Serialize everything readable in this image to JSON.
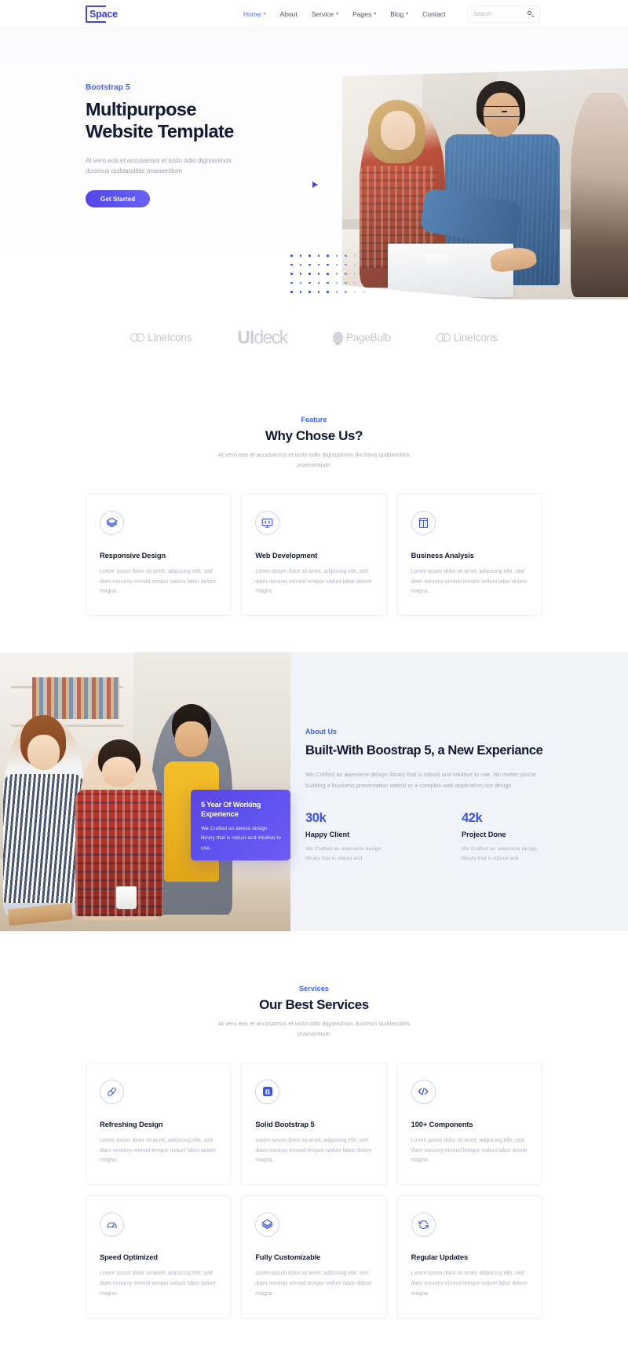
{
  "header": {
    "logo_text": "Space",
    "nav": [
      {
        "label": "Home",
        "caret": true,
        "active": true
      },
      {
        "label": "About",
        "caret": false,
        "active": false
      },
      {
        "label": "Service",
        "caret": true,
        "active": false
      },
      {
        "label": "Pages",
        "caret": true,
        "active": false
      },
      {
        "label": "Blog",
        "caret": true,
        "active": false
      },
      {
        "label": "Contact",
        "caret": false,
        "active": false
      }
    ],
    "search_placeholder": "Search",
    "search_value": ""
  },
  "hero": {
    "eyebrow": "Bootstrap 5",
    "title_line1": "Multipurpose",
    "title_line2": "Website Template",
    "subtitle": "At vero eos et accusamus et iusto odio dignissimos ducimus quiblanditiis praesentium",
    "cta_label": "Get Started"
  },
  "brands": [
    {
      "name": "LineIcons",
      "mark": "infinity-icon"
    },
    {
      "name": "UIdeck",
      "mark": "uideck-wordmark"
    },
    {
      "name": "PageBulb",
      "mark": "bulb-icon"
    },
    {
      "name": "LineIcons",
      "mark": "infinity-icon"
    }
  ],
  "feature": {
    "eyebrow": "Feature",
    "title": "Why Chose Us?",
    "description": "At vero eos et accusamus et iusto odio dignissimos ducimus quiblanditiis praesentium",
    "cards": [
      {
        "icon": "layers-icon",
        "title": "Responsive Design",
        "text": "Lorem ipsum dolor sit amet, adipscing elitr, sed diam nonumy eirmod tempor ividunt labor dolore magna."
      },
      {
        "icon": "monitor-code-icon",
        "title": "Web Development",
        "text": "Lorem ipsum dolor sit amet, adipscing elitr, sed diam nonumy eirmod tempor ividunt labor dolore magna."
      },
      {
        "icon": "grid-analysis-icon",
        "title": "Business Analysis",
        "text": "Lorem ipsum dolor sit amet, adipscing elitr, sed diam nonumy eirmod tempor ividunt labor dolore magna."
      }
    ]
  },
  "about": {
    "eyebrow": "About Us",
    "title": "Built-With Boostrap 5, a New Experiance",
    "description": "We Crafted an awesome design library that is robust and intuitive to use. No matter you're building a business presentation websit or a complex web application our design",
    "badge": {
      "title": "5 Year Of Working Experience",
      "text": "We Crafted an aweso design library that is robust and intuitive to use."
    },
    "stats": [
      {
        "number": "30k",
        "label": "Happy Client",
        "text": "We Crafted an awesome design library that is robust and"
      },
      {
        "number": "42k",
        "label": "Project Done",
        "text": "We Crafted an awesome design library that is robust and"
      }
    ]
  },
  "services": {
    "eyebrow": "Services",
    "title": "Our Best Services",
    "description": "At vero eos et accusamus et iusto odio dignissimos ducimus quiblanditiis praesentium",
    "cards": [
      {
        "icon": "pill-icon",
        "title": "Refreshing Design",
        "text": "Lorem ipsum dolor sit amet, adipscing elitr, sed diam nonumy eirmod tempor ividunt labor dolore magna."
      },
      {
        "icon": "bootstrap-b-icon",
        "title": "Solid Bootstrap 5",
        "text": "Lorem ipsum dolor sit amet, adipscing elitr, sed diam nonumy eirmod tempor ividunt labor dolore magna."
      },
      {
        "icon": "code-brackets-icon",
        "title": "100+ Components",
        "text": "Lorem ipsum dolor sit amet, adipscing elitr, sed diam nonumy eirmod tempor ividunt labor dolore magna."
      },
      {
        "icon": "speedometer-icon",
        "title": "Speed Optimized",
        "text": "Lorem ipsum dolor sit amet, adipscing elitr, sed diam nonumy eirmod tempor ividunt labor dolore magna."
      },
      {
        "icon": "layers-icon",
        "title": "Fully Customizable",
        "text": "Lorem ipsum dolor sit amet, adipscing elitr, sed diam nonumy eirmod tempor ividunt labor dolore magna."
      },
      {
        "icon": "refresh-icon",
        "title": "Regular Updates",
        "text": "Lorem ipsum dolor sit amet, adipscing elitr, sed diam nonumy eirmod tempor ividunt labor dolore magna."
      }
    ]
  },
  "colors": {
    "primary": "#4f46e5",
    "accent_blue": "#3b63f6",
    "heading": "#121a33",
    "muted": "#a7acb9",
    "about_bg": "#f1f3fb"
  }
}
